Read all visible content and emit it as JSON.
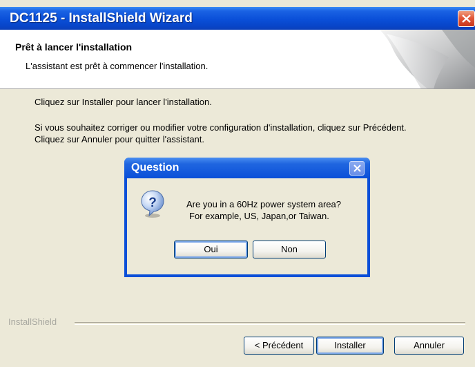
{
  "window": {
    "title": "DC1125 - InstallShield Wizard"
  },
  "header": {
    "title": "Prêt à lancer l'installation",
    "subtitle": "L'assistant est prêt à commencer l'installation."
  },
  "body": {
    "line1": "Cliquez sur Installer pour lancer l'installation.",
    "line2": "Si vous souhaitez corriger ou modifier votre configuration d'installation, cliquez sur Précédent.",
    "line3": "Cliquez sur Annuler pour quitter l'assistant."
  },
  "footer": {
    "brand": "InstallShield",
    "back_label": "< Précédent",
    "install_label": "Installer",
    "cancel_label": "Annuler"
  },
  "dialog": {
    "title": "Question",
    "icon": "question-icon",
    "message_line1": "Are you in a 60Hz power system area?",
    "message_line2": "For example, US, Japan,or Taiwan.",
    "yes_label": "Oui",
    "no_label": "Non"
  },
  "colors": {
    "titlebar": "#0a4fd8",
    "window_bg": "#ece9d8",
    "close_red": "#e2583a"
  }
}
